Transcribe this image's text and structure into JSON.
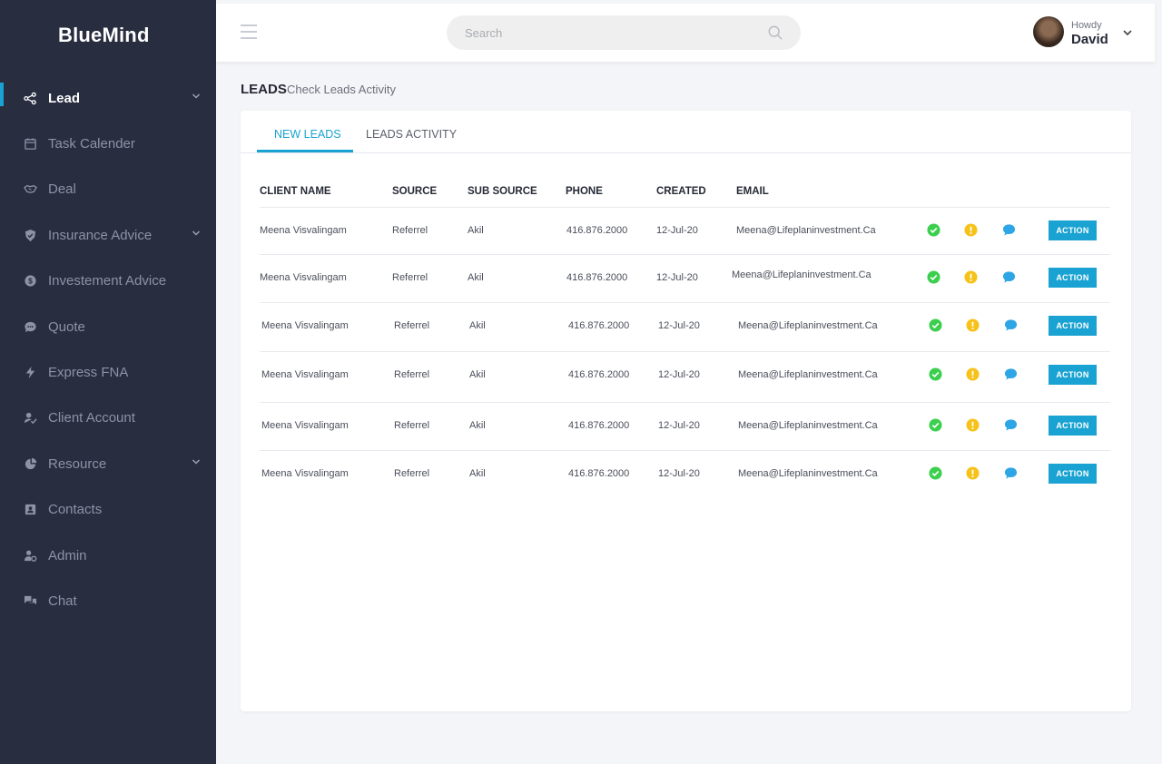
{
  "brand": {
    "name": "BlueMind"
  },
  "nav": {
    "items": [
      {
        "label": "Lead",
        "icon": "share-nodes-icon",
        "active": true,
        "has_submenu": true
      },
      {
        "label": "Task Calender",
        "icon": "calendar-icon",
        "active": false,
        "has_submenu": false
      },
      {
        "label": "Deal",
        "icon": "handshake-icon",
        "active": false,
        "has_submenu": false
      },
      {
        "label": "Insurance Advice",
        "icon": "shield-icon",
        "active": false,
        "has_submenu": true
      },
      {
        "label": "Investement Advice",
        "icon": "dollar-coin-icon",
        "active": false,
        "has_submenu": false
      },
      {
        "label": "Quote",
        "icon": "quote-bubble-icon",
        "active": false,
        "has_submenu": false
      },
      {
        "label": "Express FNA",
        "icon": "bolt-icon",
        "active": false,
        "has_submenu": false
      },
      {
        "label": "Client Account",
        "icon": "user-check-icon",
        "active": false,
        "has_submenu": false
      },
      {
        "label": "Resource",
        "icon": "pie-chart-icon",
        "active": false,
        "has_submenu": true
      },
      {
        "label": "Contacts",
        "icon": "contact-card-icon",
        "active": false,
        "has_submenu": false
      },
      {
        "label": "Admin",
        "icon": "user-gear-icon",
        "active": false,
        "has_submenu": false
      },
      {
        "label": "Chat",
        "icon": "chat-icon",
        "active": false,
        "has_submenu": false
      }
    ]
  },
  "topbar": {
    "search_placeholder": "Search",
    "greeting": "Howdy",
    "username": "David"
  },
  "page": {
    "title": "LEADS",
    "subtitle": "Check Leads Activity"
  },
  "tabs": [
    {
      "label": "NEW LEADS",
      "active": true
    },
    {
      "label": "LEADS ACTIVITY",
      "active": false
    }
  ],
  "table": {
    "columns": [
      "CLIENT NAME",
      "SOURCE",
      "SUB SOURCE",
      "PHONE",
      "CREATED",
      "EMAIL"
    ],
    "action_label": "ACTION",
    "rows": [
      {
        "client": "Meena Visvalingam",
        "source": "Referrel",
        "sub_source": "Akil",
        "phone": "416.876.2000",
        "created": "12-Jul-20",
        "email": "Meena@Lifeplaninvestment.Ca"
      },
      {
        "client": "Meena Visvalingam",
        "source": "Referrel",
        "sub_source": "Akil",
        "phone": "416.876.2000",
        "created": "12-Jul-20",
        "email": "Meena@Lifeplaninvestment.Ca"
      },
      {
        "client": "Meena Visvalingam",
        "source": "Referrel",
        "sub_source": "Akil",
        "phone": "416.876.2000",
        "created": "12-Jul-20",
        "email": "Meena@Lifeplaninvestment.Ca"
      },
      {
        "client": "Meena Visvalingam",
        "source": "Referrel",
        "sub_source": "Akil",
        "phone": "416.876.2000",
        "created": "12-Jul-20",
        "email": "Meena@Lifeplaninvestment.Ca"
      },
      {
        "client": "Meena Visvalingam",
        "source": "Referrel",
        "sub_source": "Akil",
        "phone": "416.876.2000",
        "created": "12-Jul-20",
        "email": "Meena@Lifeplaninvestment.Ca"
      },
      {
        "client": "Meena Visvalingam",
        "source": "Referrel",
        "sub_source": "Akil",
        "phone": "416.876.2000",
        "created": "12-Jul-20",
        "email": "Meena@Lifeplaninvestment.Ca"
      }
    ]
  },
  "colors": {
    "sidebar_bg": "#282d40",
    "accent": "#1aa3d2",
    "status_ok": "#3ccf4e",
    "status_warning": "#f6c21a",
    "status_chat": "#2ea6e6"
  }
}
